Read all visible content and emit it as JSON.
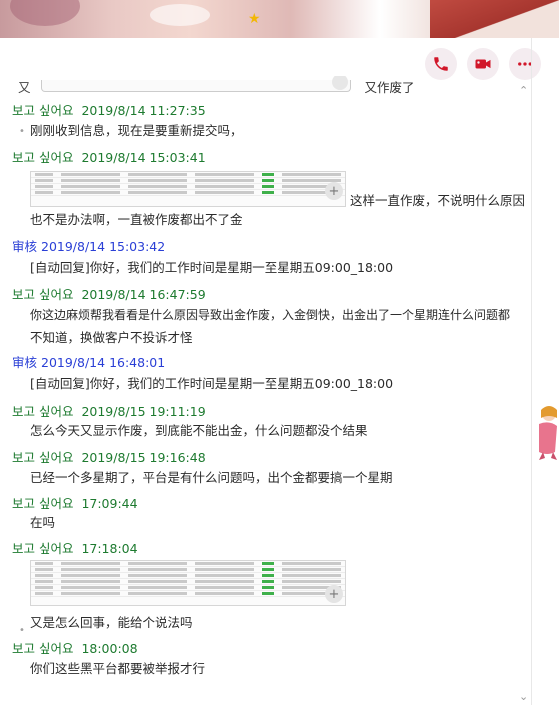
{
  "toolbar": {
    "call_icon": "phone-icon",
    "video_icon": "video-camera-icon",
    "more_icon": "more-icon",
    "accent": "#d1172a"
  },
  "top_cut": {
    "prefix": "又",
    "tail": "又作废了"
  },
  "messages": [
    {
      "sender": "보고 싶어요",
      "time": "2019/8/14 11:27:35",
      "text": "刚刚收到信息，现在是要重新提交吗，",
      "bullet": "•"
    },
    {
      "sender": "보고 싶어요",
      "time": "2019/8/14 15:03:41",
      "after_image": "这样一直作废，不说明什么原因",
      "text": "也不是办法啊，一直被作废都出不了金"
    },
    {
      "sender": "审核",
      "time": "2019/8/14 15:03:42",
      "text": "[自动回复]你好，我们的工作时间是星期一至星期五09:00_18:00"
    },
    {
      "sender": "보고 싶어요",
      "time": "2019/8/14 16:47:59",
      "text_line1": "你这边麻烦帮我看看是什么原因导致出金作废，入金倒快，出金出了一个星期连什么问题都",
      "text_line2": "不知道，换做客户不投诉才怪"
    },
    {
      "sender": "审核",
      "time": "2019/8/14 16:48:01",
      "text": "[自动回复]你好，我们的工作时间是星期一至星期五09:00_18:00"
    },
    {
      "sender": "보고 싶어요",
      "time": "2019/8/15 19:11:19",
      "text": "怎么今天又显示作废，到底能不能出金，什么问题都没个结果"
    },
    {
      "sender": "보고 싶어요",
      "time": "2019/8/15 19:16:48",
      "text": "已经一个多星期了，平台是有什么问题吗，出个金都要搞一个星期"
    },
    {
      "sender": "보고 싶어요",
      "time": "17:09:44",
      "text": "在吗"
    },
    {
      "sender": "보고 싶어요",
      "time": "17:18:04",
      "bullet": "•",
      "text": "又是怎么回事，能给个说法吗"
    },
    {
      "sender": "보고 싶어요",
      "time": "18:00:08",
      "text": "你们这些黑平台都要被举报才行"
    }
  ],
  "colors": {
    "user": "#1d7a2f",
    "audit": "#2a3fd6"
  }
}
